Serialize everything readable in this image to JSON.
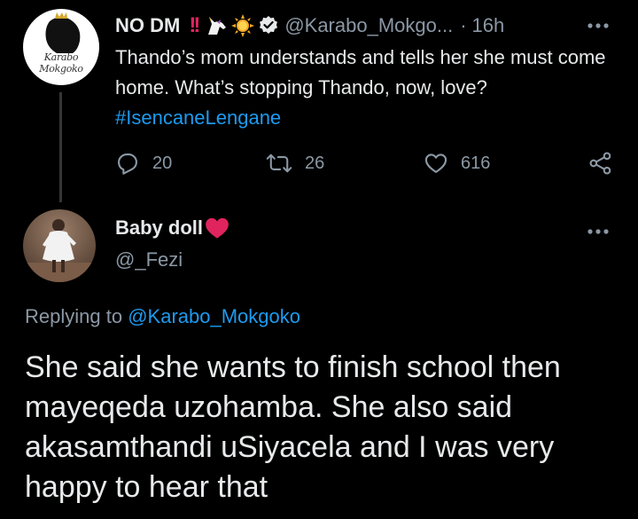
{
  "tweet": {
    "author": {
      "display_name": "NO DM",
      "badges": "!!",
      "emojis": [
        "unicorn-emoji",
        "sun-emoji"
      ],
      "verified_icon": "verified-badge-icon",
      "handle": "@Karabo_Mokgo...",
      "separator": "·",
      "time": "16h",
      "avatar_text": "Karabo Mokgoko"
    },
    "text": "Thando’s mom understands and tells her she must come home. What’s stopping Thando, now, love?",
    "hashtag": "#IsencaneLengane",
    "stats": {
      "replies": "20",
      "retweets": "26",
      "likes": "616"
    },
    "icons": [
      "reply-icon",
      "retweet-icon",
      "like-icon",
      "share-icon",
      "more-icon"
    ]
  },
  "reply": {
    "author": {
      "display_name": "Baby doll",
      "name_emoji": "red-heart-emoji",
      "handle": "@_Fezi"
    },
    "replying_prefix": "Replying to",
    "replying_to": "@Karabo_Mokgoko",
    "text": "She said she wants to finish school then mayeqeda uzohamba. She also said akasamthandi uSiyacela and I was very happy to hear that"
  },
  "colors": {
    "background": "#000000",
    "text": "#e7e9ea",
    "secondary_text": "#8b98a5",
    "link": "#1d9bf0",
    "alert_red": "#e0245e",
    "heart_red": "#e0245e"
  }
}
